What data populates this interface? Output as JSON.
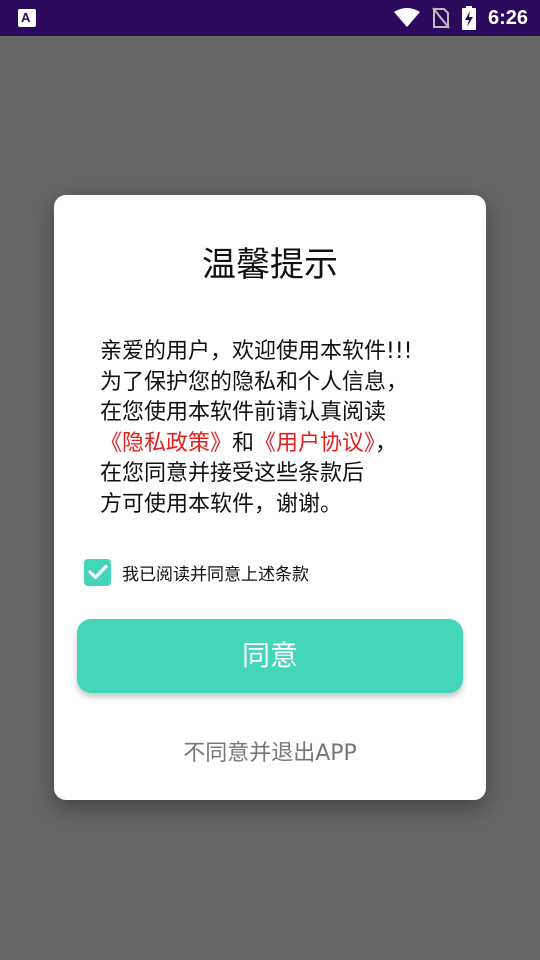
{
  "status_bar": {
    "app_icon_letter": "A",
    "time": "6:26"
  },
  "dialog": {
    "title": "温馨提示",
    "body": {
      "line1": "亲爱的用户，欢迎使用本软件!!!",
      "line2": "为了保护您的隐私和个人信息，",
      "line3": "在您使用本软件前请认真阅读",
      "privacy_link": "《隐私政策》",
      "and_text": "和",
      "user_agreement_link": "《用户协议》",
      "line4_end": "，",
      "line5": "在您同意并接受这些条款后",
      "line6": "方可使用本软件，谢谢。"
    },
    "checkbox_label": "我已阅读并同意上述条款",
    "checkbox_checked": true,
    "agree_button": "同意",
    "exit_link": "不同意并退出APP"
  },
  "colors": {
    "accent": "#44d6b9",
    "link": "#e61e1e",
    "status_bar": "#2b0a5e",
    "overlay": "#666666"
  }
}
